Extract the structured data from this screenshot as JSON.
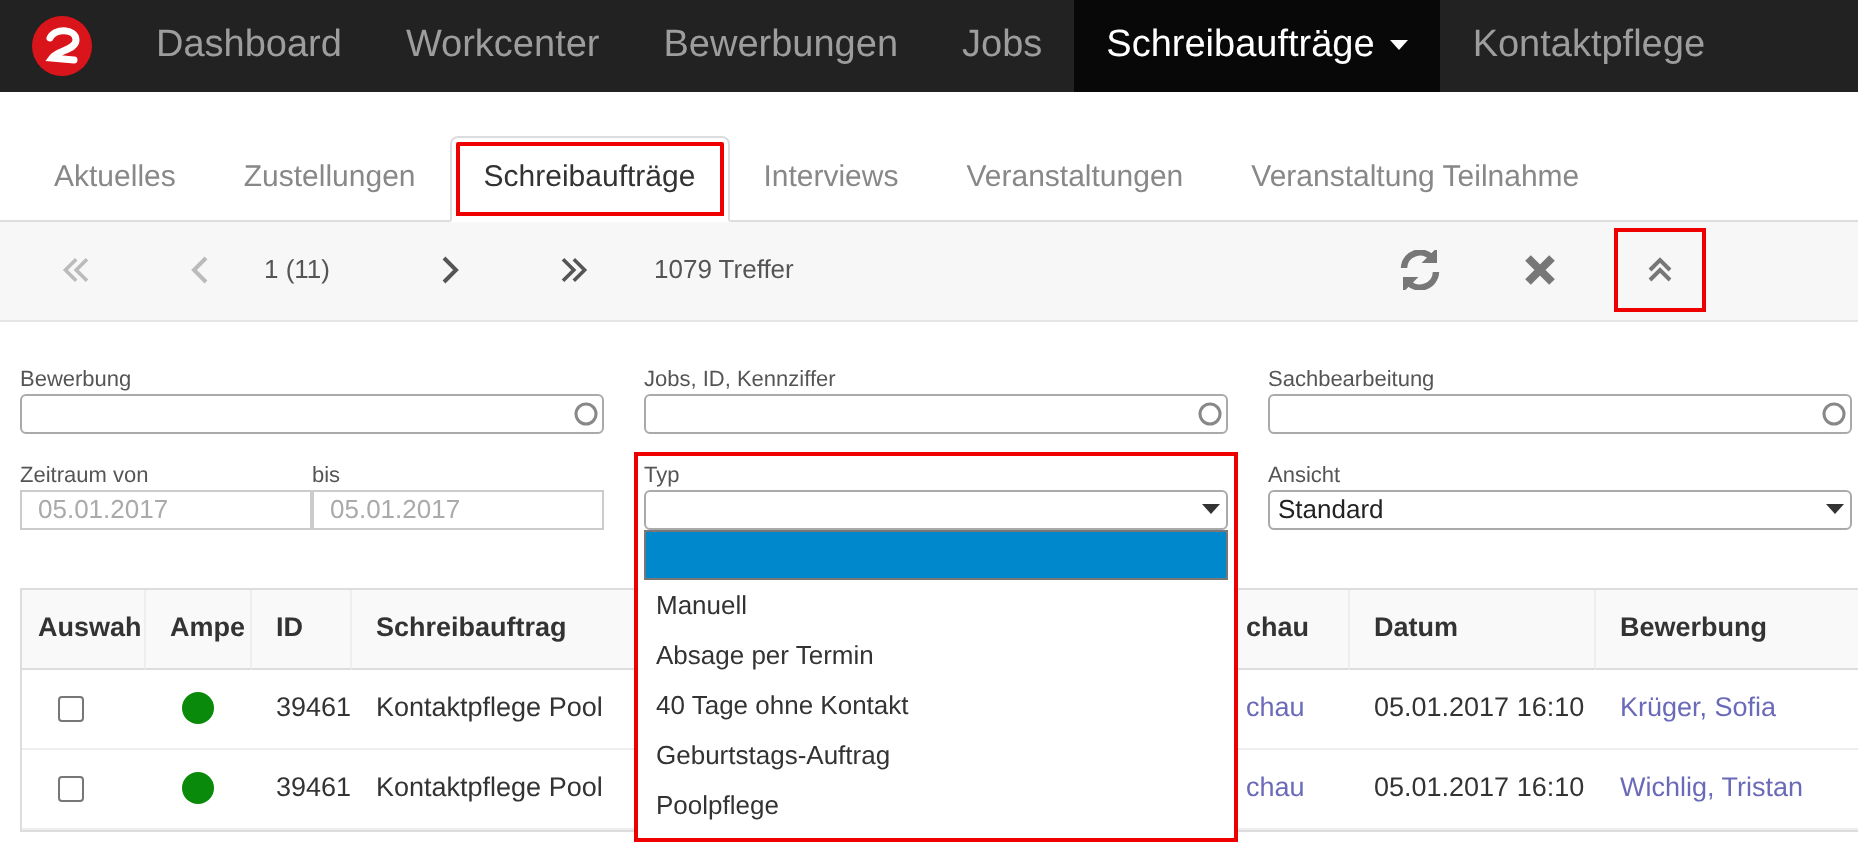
{
  "navbar": {
    "items": [
      {
        "label": "Dashboard",
        "selected": false,
        "has_menu": false
      },
      {
        "label": "Workcenter",
        "selected": false,
        "has_menu": false
      },
      {
        "label": "Bewerbungen",
        "selected": false,
        "has_menu": false
      },
      {
        "label": "Jobs",
        "selected": false,
        "has_menu": false
      },
      {
        "label": "Schreibaufträge",
        "selected": true,
        "has_menu": true
      },
      {
        "label": "Kontaktpflege",
        "selected": false,
        "has_menu": false
      }
    ]
  },
  "tabs": [
    {
      "label": "Aktuelles",
      "selected": false,
      "highlighted": false
    },
    {
      "label": "Zustellungen",
      "selected": false,
      "highlighted": false
    },
    {
      "label": "Schreibaufträge",
      "selected": true,
      "highlighted": true
    },
    {
      "label": "Interviews",
      "selected": false,
      "highlighted": false
    },
    {
      "label": "Veranstaltungen",
      "selected": false,
      "highlighted": false
    },
    {
      "label": "Veranstaltung Teilnahme",
      "selected": false,
      "highlighted": false
    }
  ],
  "pager": {
    "first_disabled": true,
    "prev_disabled": true,
    "page": "1 (11)",
    "next_disabled": false,
    "last_disabled": false,
    "count": "1079 Treffer"
  },
  "toolbar_buttons": [
    {
      "kind": "refresh",
      "highlighted": false
    },
    {
      "kind": "clear",
      "highlighted": false
    },
    {
      "kind": "collapse",
      "highlighted": true
    }
  ],
  "filters": {
    "search_fields": [
      {
        "label": "Bewerbung"
      },
      {
        "label": "Jobs, ID, Kennziffer"
      },
      {
        "label": "Sachbearbeitung"
      }
    ],
    "date_range": {
      "from_label": "Zeitraum von",
      "from_value": "05.01.2017",
      "to_label": "bis",
      "to_value": "05.01.2017",
      "disabled": true
    },
    "type_select": {
      "label": "Typ",
      "open": true,
      "highlighted": true,
      "options": [
        {
          "selected": true
        },
        {
          "label": "Manuell",
          "selected": false
        },
        {
          "label": "Absage per Termin",
          "selected": false
        },
        {
          "label": "40 Tage ohne Kontakt",
          "selected": false
        },
        {
          "label": "Geburtstags-Auftrag",
          "selected": false
        },
        {
          "label": "Poolpflege",
          "selected": false
        }
      ]
    },
    "view_select": {
      "label": "Ansicht",
      "value": "Standard"
    }
  },
  "table": {
    "columns": [
      "Auswah",
      "Ampe",
      "ID",
      "Schreibauftrag",
      "chau",
      "Datum",
      "Bewerbung"
    ],
    "rows": [
      {
        "checked": false,
        "color": "#0a8a0a",
        "id": "39461",
        "schreibauftrag": "Kontaktpflege Pool",
        "column_5": "chau",
        "datum": "05.01.2017 16:10",
        "bewerbung": "Krüger, Sofia"
      },
      {
        "checked": false,
        "color": "#0a8a0a",
        "id": "39461",
        "schreibauftrag": "Kontaktpflege Pool",
        "column_5": "chau",
        "datum": "05.01.2017 16:10",
        "bewerbung": "Wichlig, Tristan"
      }
    ]
  }
}
